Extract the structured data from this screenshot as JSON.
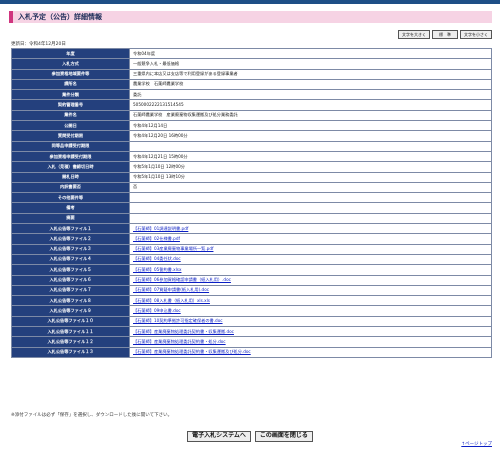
{
  "header": {
    "title": "入札予定（公告）詳細情報"
  },
  "font_size": {
    "larger": "文字を大きく",
    "standard": "標　準",
    "smaller": "文字を小さく"
  },
  "updated": "更新日：令和4年12月20日",
  "rows": [
    {
      "label": "年度",
      "value": "令和04年度"
    },
    {
      "label": "入札方式",
      "value": "一般競争入札・最低価格"
    },
    {
      "label": "参加資格地域要件等",
      "value": "三重県内に本店又は支店等で利用登録がある登録事業者"
    },
    {
      "label": "課所名",
      "value": "農業学校　石薬師農業学校"
    },
    {
      "label": "業件分類",
      "value": "委託"
    },
    {
      "label": "契約管理番号",
      "value": "5050002222131514545"
    },
    {
      "label": "業件名",
      "value": "石薬師農業学校　産業廃棄物収集運搬及び処分業務委託"
    },
    {
      "label": "公開日",
      "value": "令和4年12月14日"
    },
    {
      "label": "質問受付期限",
      "value": "令和4年12月20日 16時00分"
    },
    {
      "label": "同等品申請受付期限",
      "value": ""
    },
    {
      "label": "参加資格申請受付期限",
      "value": "令和4年12月21日 15時00分"
    },
    {
      "label": "入札（見積）書締切日時",
      "value": "令和5年1月10日 12時00分"
    },
    {
      "label": "開札日時",
      "value": "令和5年1月10日 13時10分"
    },
    {
      "label": "内訳書要否",
      "value": "否"
    },
    {
      "label": "その他要件等",
      "value": ""
    },
    {
      "label": "備考",
      "value": ""
    },
    {
      "label": "摘要",
      "value": ""
    },
    {
      "label": "入札公告等ファイル１",
      "value": "【石薬師】01調達説明書.pdf",
      "link": true
    },
    {
      "label": "入札公告等ファイル２",
      "value": "【石薬師】02仕様書.pdf",
      "link": true
    },
    {
      "label": "入札公告等ファイル３",
      "value": "【石薬師】03産業廃棄物事業場所一覧.pdf",
      "link": true
    },
    {
      "label": "入札公告等ファイル４",
      "value": "【石薬師】04委任状.doc",
      "link": true
    },
    {
      "label": "入札公告等ファイル５",
      "value": "【石薬師】05誓約書.xlsx",
      "link": true
    },
    {
      "label": "入札公告等ファイル６",
      "value": "【石薬師】06参加資格確認申請書（紙入札用）.doc",
      "link": true
    },
    {
      "label": "入札公告等ファイル７",
      "value": "【石薬師】07質疑申請書(紙入札用).doc",
      "link": true
    },
    {
      "label": "入札公告等ファイル８",
      "value": "【石薬師】08入札書（紙入札用）xls.xls",
      "link": true
    },
    {
      "label": "入札公告等ファイル９",
      "value": "【石薬師】09申込書.doc",
      "link": true
    },
    {
      "label": "入札公告等ファイル１０",
      "value": "【石薬師】10契約準拠許可指定確保者の書.doc",
      "link": true
    },
    {
      "label": "入札公告等ファイル１１",
      "value": "【石薬師】産業廃棄物処理委託契約書・収集運搬.doc",
      "link": true
    },
    {
      "label": "入札公告等ファイル１２",
      "value": "【石薬師】産業廃棄物処理委託契約書・処分.doc",
      "link": true
    },
    {
      "label": "入札公告等ファイル１３",
      "value": "【石薬師】産業廃棄物処理委託契約書・収集運搬及び処分.doc",
      "link": true
    }
  ],
  "note": "※添付ファイルは必ず「保存」を選択し、ダウンロードした後に開いて下さい。",
  "buttons": {
    "system": "電子入札システムへ",
    "close": "この画面を閉じる"
  },
  "page_top": "↑ページトップ"
}
